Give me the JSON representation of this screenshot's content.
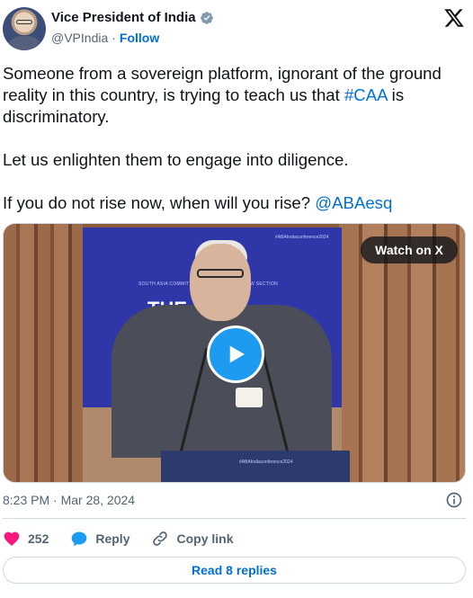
{
  "author": {
    "name": "Vice President of India",
    "handle": "@VPIndia",
    "separator": "·",
    "follow_label": "Follow"
  },
  "tweet": {
    "line1_pre": "Someone from a sovereign platform, ignorant of the ground reality in this country, is trying to teach us that ",
    "line1_hashtag": "#CAA",
    "line1_post": " is discriminatory.",
    "line2": "Let us enlighten them to engage into diligence.",
    "line3_pre": "If you do not rise now, when will you rise? ",
    "line3_mention": "@ABAesq"
  },
  "media": {
    "watch_label": "Watch on X",
    "banner_tag": "#ABAIndiaconference2024",
    "banner_section": "SOUTH ASIA COMMITTEE · INTERNATIONAL LAW SECTION",
    "banner_big": "THE",
    "podium_tag": "#ABAIndiaconference2024"
  },
  "meta": {
    "timestamp": "8:23 PM · Mar 28, 2024"
  },
  "actions": {
    "likes_count": "252",
    "reply_label": "Reply",
    "copy_label": "Copy link"
  },
  "read_replies_label": "Read 8 replies",
  "colors": {
    "link": "#006fd6",
    "like": "#f91880",
    "play": "#1d9bf0",
    "verified": "#829aab"
  }
}
